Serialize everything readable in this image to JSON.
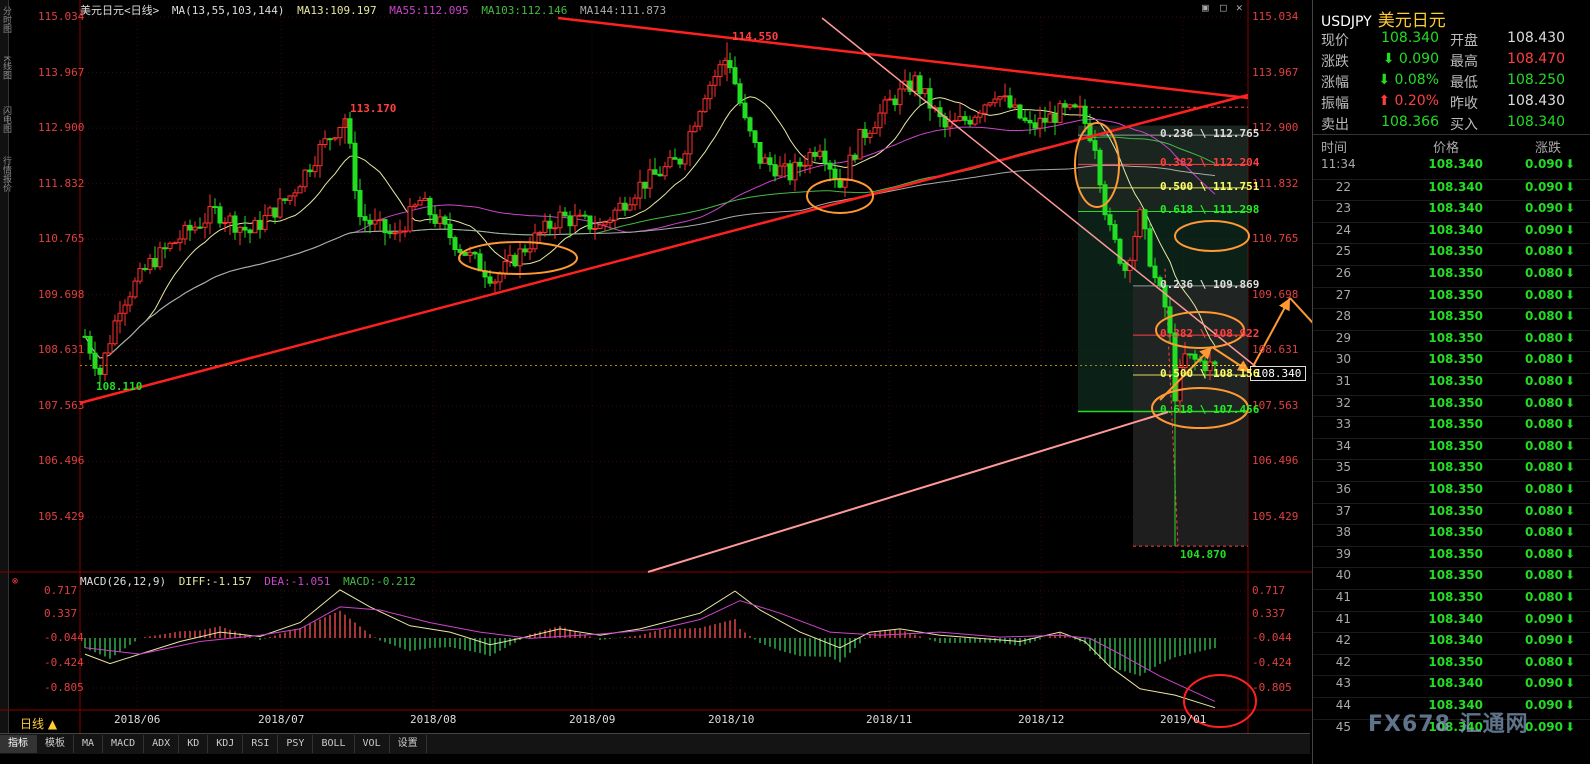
{
  "header": {
    "symbol": "美元日元<日线>",
    "indicator_name": "MA(13,55,103,144)",
    "ma13": "MA13:109.197",
    "ma55": "MA55:112.095",
    "ma103": "MA103:112.146",
    "ma144": "MA144:111.873"
  },
  "price_axis": [
    "115.034",
    "113.967",
    "112.900",
    "111.832",
    "110.765",
    "109.698",
    "108.631",
    "107.563",
    "106.496",
    "105.429"
  ],
  "current_price_tag": "108.340",
  "annotations": {
    "high_label": "114.550",
    "peak2_label": "113.170",
    "low_left_label": "108.110",
    "low_right_label": "104.870",
    "fib": [
      "0.236 \\ 112.765",
      "0.382 \\ 112.204",
      "0.500 \\ 111.751",
      "0.618 \\ 111.298",
      "0.236 \\ 109.869",
      "0.382 \\ 108.922",
      "0.500 \\ 108.156",
      "0.618 \\ 107.456"
    ]
  },
  "macd": {
    "title": "MACD(26,12,9)",
    "diff": "DIFF:-1.157",
    "dea": "DEA:-1.051",
    "macd": "MACD:-0.212",
    "axis": [
      "0.717",
      "0.337",
      "-0.044",
      "-0.424",
      "-0.805"
    ]
  },
  "x_axis": [
    "2018/06",
    "2018/07",
    "2018/08",
    "2018/09",
    "2018/10",
    "2018/11",
    "2018/12",
    "2019/01"
  ],
  "period_tab": "日线 ▲",
  "bottom_tabs": [
    "指标",
    "模板",
    "MA",
    "MACD",
    "ADX",
    "KD",
    "KDJ",
    "RSI",
    "PSY",
    "BOLL",
    "VOL",
    "设置"
  ],
  "left_strip": [
    "分时图",
    "K线图",
    "闪电图",
    "行情报价"
  ],
  "panel": {
    "symbol": "USDJPY",
    "name_cn": "美元日元",
    "quote": [
      {
        "l1": "现价",
        "v1": "108.340",
        "c1": "g",
        "l2": "开盘",
        "v2": "108.430",
        "c2": "w"
      },
      {
        "l1": "涨跌",
        "v1": "⬇ 0.090",
        "c1": "g",
        "l2": "最高",
        "v2": "108.470",
        "c2": "r"
      },
      {
        "l1": "涨幅",
        "v1": "⬇ 0.08%",
        "c1": "g",
        "l2": "最低",
        "v2": "108.250",
        "c2": "g"
      },
      {
        "l1": "振幅",
        "v1": "⬆ 0.20%",
        "c1": "r",
        "l2": "昨收",
        "v2": "108.430",
        "c2": "w"
      },
      {
        "l1": "卖出",
        "v1": "108.366",
        "c1": "g",
        "l2": "买入",
        "v2": "108.340",
        "c2": "g"
      }
    ],
    "tick_header": {
      "time": "时间",
      "price": "价格",
      "change": "涨跌"
    },
    "ticks": [
      {
        "t": "11:34",
        "p": "108.340",
        "c": "0.090"
      },
      {
        "t": "22",
        "p": "108.340",
        "c": "0.090"
      },
      {
        "t": "23",
        "p": "108.340",
        "c": "0.090"
      },
      {
        "t": "24",
        "p": "108.340",
        "c": "0.090"
      },
      {
        "t": "25",
        "p": "108.350",
        "c": "0.080"
      },
      {
        "t": "26",
        "p": "108.350",
        "c": "0.080"
      },
      {
        "t": "27",
        "p": "108.350",
        "c": "0.080"
      },
      {
        "t": "28",
        "p": "108.350",
        "c": "0.080"
      },
      {
        "t": "29",
        "p": "108.350",
        "c": "0.080"
      },
      {
        "t": "30",
        "p": "108.350",
        "c": "0.080"
      },
      {
        "t": "31",
        "p": "108.350",
        "c": "0.080"
      },
      {
        "t": "32",
        "p": "108.350",
        "c": "0.080"
      },
      {
        "t": "33",
        "p": "108.350",
        "c": "0.080"
      },
      {
        "t": "34",
        "p": "108.350",
        "c": "0.080"
      },
      {
        "t": "35",
        "p": "108.350",
        "c": "0.080"
      },
      {
        "t": "36",
        "p": "108.350",
        "c": "0.080"
      },
      {
        "t": "37",
        "p": "108.350",
        "c": "0.080"
      },
      {
        "t": "38",
        "p": "108.350",
        "c": "0.080"
      },
      {
        "t": "39",
        "p": "108.350",
        "c": "0.080"
      },
      {
        "t": "40",
        "p": "108.350",
        "c": "0.080"
      },
      {
        "t": "41",
        "p": "108.350",
        "c": "0.080"
      },
      {
        "t": "41",
        "p": "108.340",
        "c": "0.090"
      },
      {
        "t": "42",
        "p": "108.340",
        "c": "0.090"
      },
      {
        "t": "42",
        "p": "108.350",
        "c": "0.080"
      },
      {
        "t": "43",
        "p": "108.340",
        "c": "0.090"
      },
      {
        "t": "44",
        "p": "108.340",
        "c": "0.090"
      },
      {
        "t": "45",
        "p": "108.340",
        "c": "0.090"
      }
    ]
  },
  "watermark": "FX678 汇通网",
  "colors": {
    "up": "#ff4040",
    "down": "#22dd22",
    "ma13": "#e8e8a0",
    "ma55": "#cc44cc",
    "ma103": "#44bb44",
    "ma144": "#aaaaaa",
    "trend": "#ff2020",
    "trend2": "#ff9999",
    "circle": "#ff9933"
  }
}
